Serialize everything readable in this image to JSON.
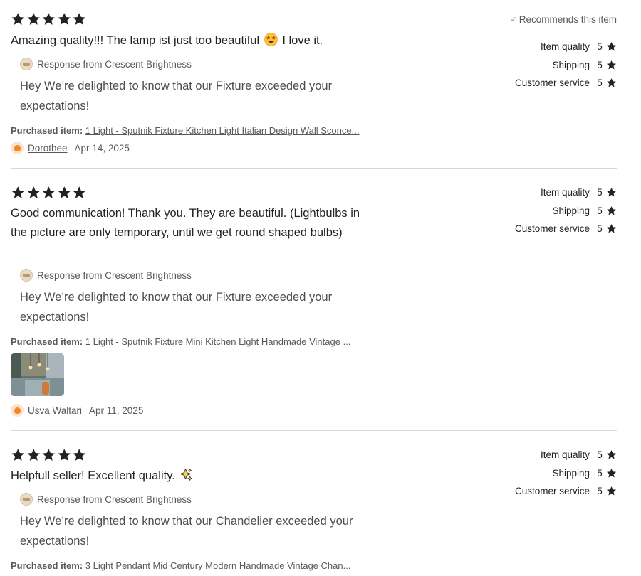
{
  "reviews": [
    {
      "rating": 5,
      "text": "Amazing quality!!! The lamp ist just too beautiful",
      "text_after_emoji": "I love it.",
      "emoji": "star-struck-emoji",
      "recommends": "Recommends this item",
      "response_from": "Response from Crescent Brightness",
      "response_text": "Hey We’re delighted to know that our Fixture exceeded your expectations!",
      "purchased_label": "Purchased item:",
      "purchased_item": "1 Light - Sputnik Fixture Kitchen Light Italian Design Wall Sconce...",
      "reviewer": "Dorothee",
      "date": "Apr 14, 2025",
      "ratings": [
        {
          "label": "Item quality",
          "value": "5"
        },
        {
          "label": "Shipping",
          "value": "5"
        },
        {
          "label": "Customer service",
          "value": "5"
        }
      ]
    },
    {
      "rating": 5,
      "text": "Good communication! Thank you. They are beautiful. (Lightbulbs in the picture are only temporary, until we get round shaped bulbs)",
      "response_from": "Response from Crescent Brightness",
      "response_text": "Hey We’re delighted to know that our Fixture exceeded your expectations!",
      "purchased_label": "Purchased item:",
      "purchased_item": "1 Light - Sputnik Fixture Mini Kitchen Light Handmade Vintage ...",
      "reviewer": "Usva Waltari",
      "date": "Apr 11, 2025",
      "ratings": [
        {
          "label": "Item quality",
          "value": "5"
        },
        {
          "label": "Shipping",
          "value": "5"
        },
        {
          "label": "Customer service",
          "value": "5"
        }
      ]
    },
    {
      "rating": 5,
      "text": "Helpfull seller! Excellent quality.",
      "emoji": "sparkles-emoji",
      "response_from": "Response from Crescent Brightness",
      "response_text": "Hey We’re delighted to know that our Chandelier exceeded your expectations!",
      "purchased_label": "Purchased item:",
      "purchased_item": "3 Light Pendant Mid Century Modern Handmade Vintage Chan...",
      "ratings": [
        {
          "label": "Item quality",
          "value": "5"
        },
        {
          "label": "Shipping",
          "value": "5"
        },
        {
          "label": "Customer service",
          "value": "5"
        }
      ]
    }
  ],
  "colors": {
    "text": "#222222",
    "muted": "#595959",
    "divider": "#d8d8d8",
    "check": "#6a9e6a"
  }
}
